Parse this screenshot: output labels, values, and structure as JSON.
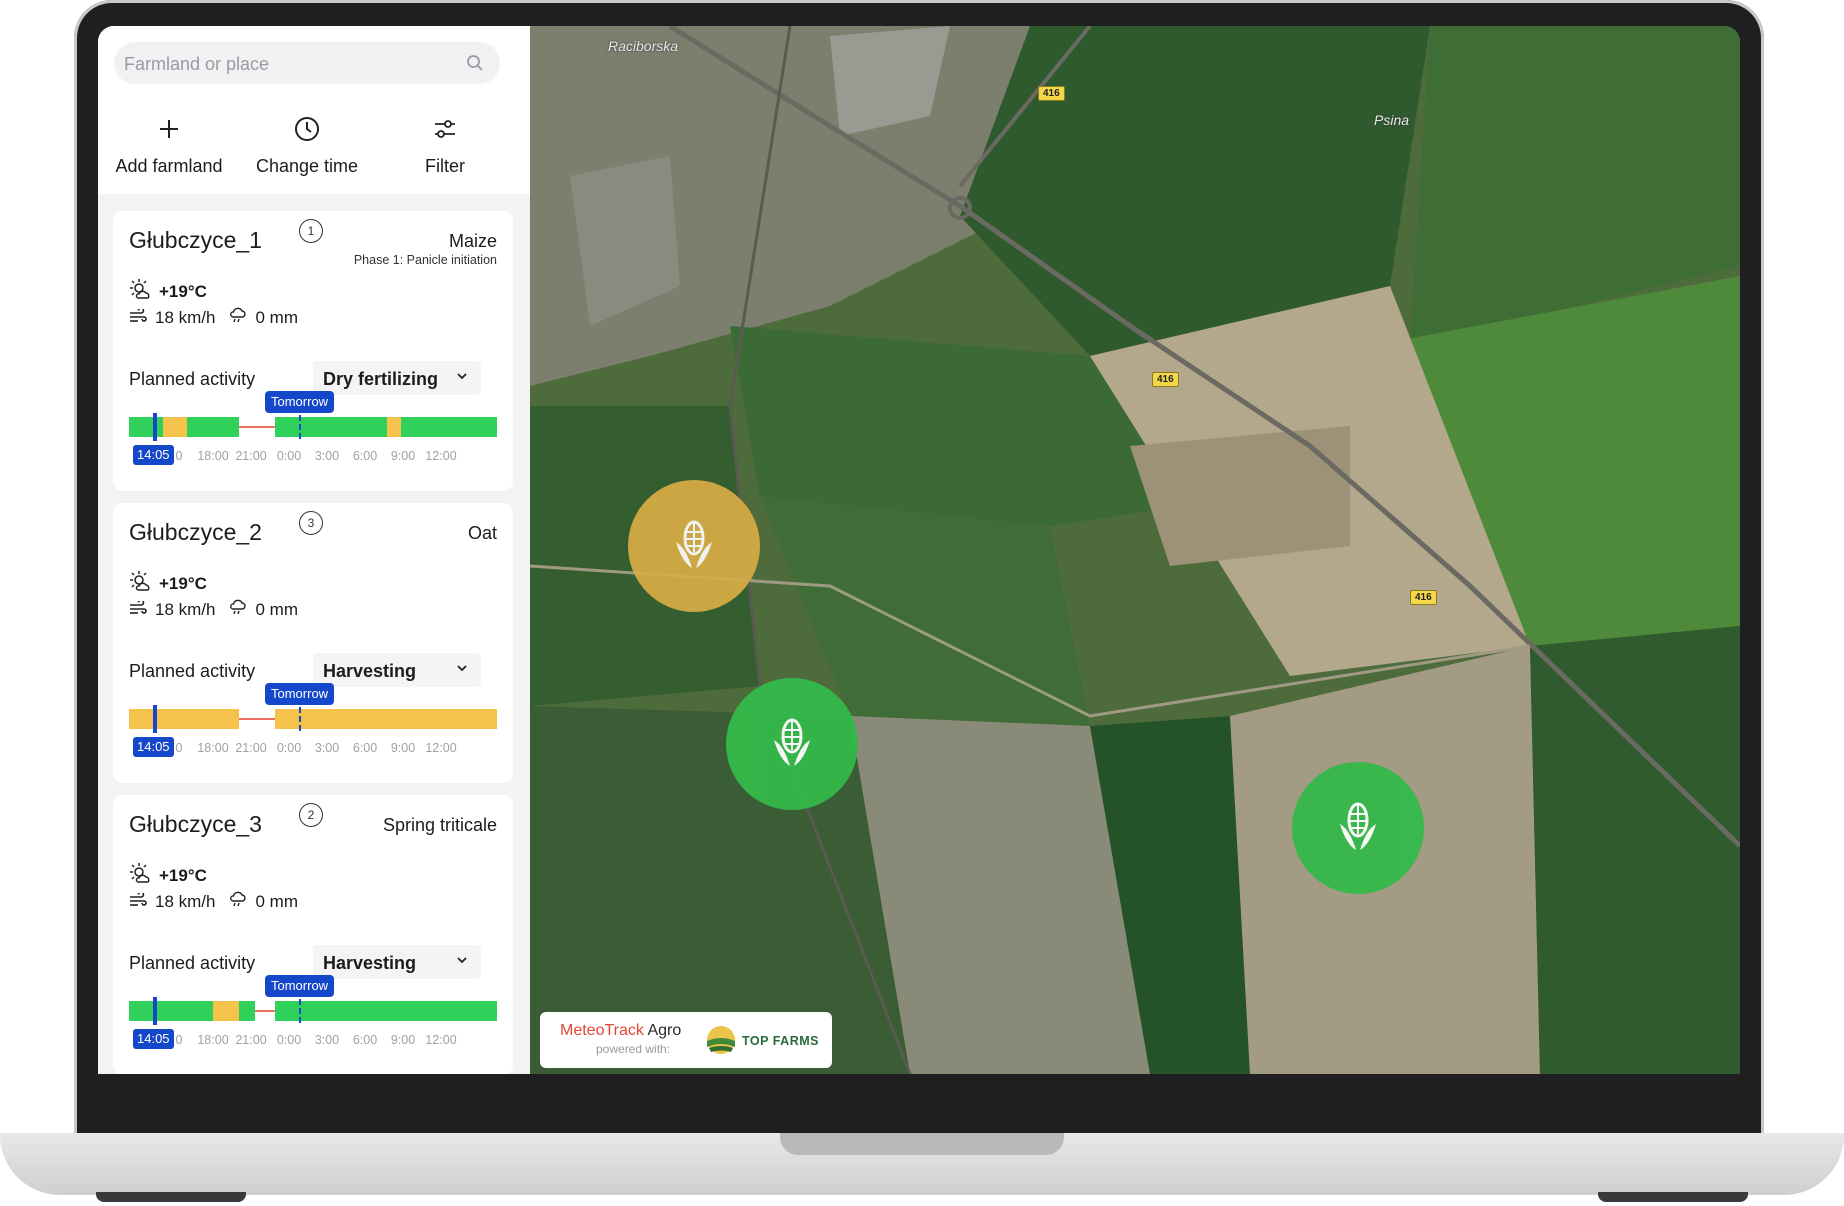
{
  "search": {
    "placeholder": "Farmland or place"
  },
  "toolbar": [
    {
      "label": "Add farmland",
      "icon": "plus-icon"
    },
    {
      "label": "Change time",
      "icon": "clock-icon"
    },
    {
      "label": "Filter",
      "icon": "sliders-icon"
    }
  ],
  "farms": [
    {
      "name": "Głubczyce_1",
      "badge": "1",
      "crop": "Maize",
      "phase": "Phase 1: Panicle initiation",
      "temp": "+19°C",
      "wind": "18 km/h",
      "rain": "0 mm",
      "activity_label": "Planned activity",
      "activity": "Dry fertilizing"
    },
    {
      "name": "Głubczyce_2",
      "badge": "3",
      "crop": "Oat",
      "phase": "",
      "temp": "+19°C",
      "wind": "18 km/h",
      "rain": "0 mm",
      "activity_label": "Planned activity",
      "activity": "Harvesting"
    },
    {
      "name": "Głubczyce_3",
      "badge": "2",
      "crop": "Spring triticale",
      "phase": "",
      "temp": "+19°C",
      "wind": "18 km/h",
      "rain": "0 mm",
      "activity_label": "Planned activity",
      "activity": "Harvesting"
    }
  ],
  "timeline": {
    "now_label": "14:05",
    "tomorrow_label": "Tomorrow",
    "ticks": [
      "0",
      "18:00",
      "21:00",
      "0:00",
      "3:00",
      "6:00",
      "9:00",
      "12:00"
    ]
  },
  "map": {
    "labels": {
      "street": "Raciborska",
      "river": "Psina",
      "road": "416"
    },
    "pins": [
      {
        "status": "yellow",
        "icon": "corn-icon"
      },
      {
        "status": "green",
        "icon": "corn-icon"
      },
      {
        "status": "green",
        "icon": "corn-icon"
      }
    ],
    "brand": {
      "name_red": "MeteoTrack",
      "name_dark": "Agro",
      "powered": "powered with:",
      "partner": "TOP FARMS"
    }
  },
  "colors": {
    "good": "#2fd15a",
    "warn": "#f5c24b",
    "accent": "#1447c9",
    "pin_yellow": "#d8ad45",
    "pin_green": "#34b94a"
  }
}
